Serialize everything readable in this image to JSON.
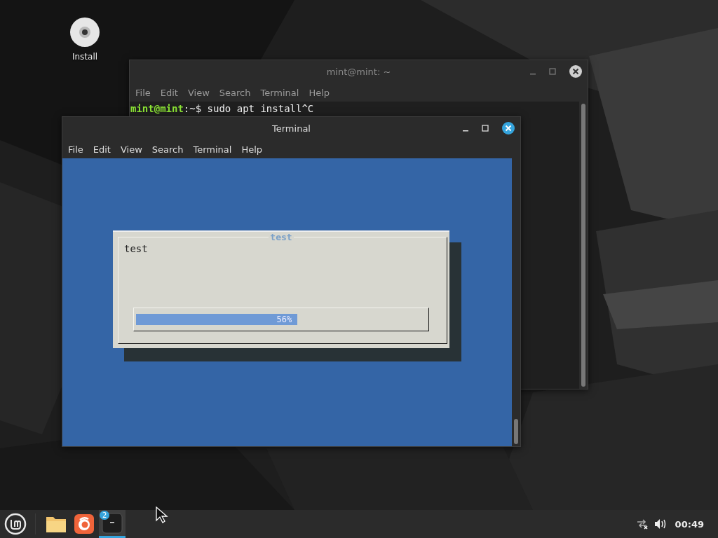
{
  "desktop_icons": [
    {
      "label": "Install"
    }
  ],
  "windows": [
    {
      "title": "mint@mint: ~",
      "focused": false,
      "menu": [
        "File",
        "Edit",
        "View",
        "Search",
        "Terminal",
        "Help"
      ],
      "lines": [
        {
          "prompt": "mint@mint",
          "path": ":~$ ",
          "command": "sudo apt install^C"
        }
      ]
    },
    {
      "title": "Terminal",
      "focused": true,
      "menu": [
        "File",
        "Edit",
        "View",
        "Search",
        "Terminal",
        "Help"
      ],
      "dialog": {
        "title": "test",
        "message": "test",
        "progress": {
          "level": 0.56,
          "reading": "56%"
        }
      }
    }
  ],
  "taskbar": {
    "apps": [
      {
        "kind": "files",
        "active": false
      },
      {
        "kind": "firefox",
        "active": false
      },
      {
        "kind": "terminal",
        "active": true,
        "badge": "2"
      }
    ],
    "clock": "00:49"
  }
}
